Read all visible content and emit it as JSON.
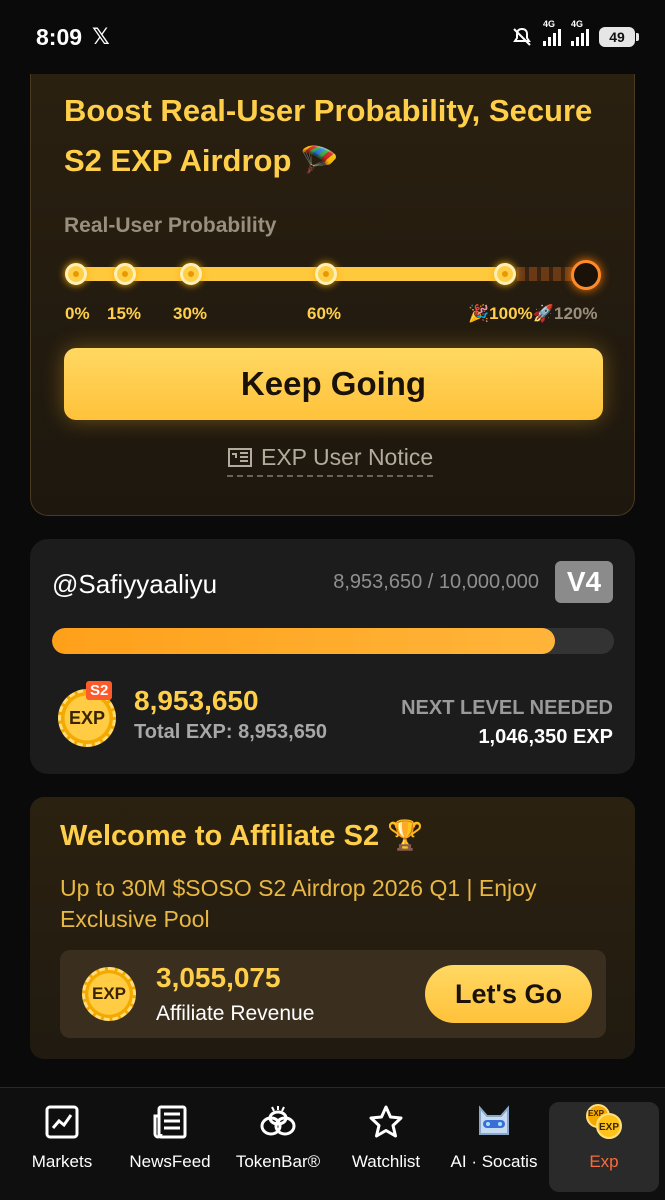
{
  "status_bar": {
    "time": "8:09",
    "x_label": "𝕏",
    "net1": "4G",
    "net2": "4G",
    "battery": "49"
  },
  "boost": {
    "title": "Boost Real-User Probability, Secure S2 EXP Airdrop 🪂",
    "probability_label": "Real-User Probability",
    "ticks": [
      "0%",
      "15%",
      "30%",
      "60%",
      "🎉100%🚀",
      "120%"
    ],
    "probability_progress_pct": 100,
    "button_label": "Keep Going",
    "notice_label": "EXP User Notice"
  },
  "level": {
    "username": "@Safiyyaaliyu",
    "progress_text": "8,953,650 / 10,000,000",
    "level_badge": "V4",
    "progress_fraction": 0.895,
    "season_tag": "S2",
    "coin_text": "EXP",
    "exp_value": "8,953,650",
    "total_exp": "Total EXP: 8,953,650",
    "next_level_label": "NEXT LEVEL NEEDED",
    "next_level_value": "1,046,350 EXP"
  },
  "affiliate": {
    "title": "Welcome to Affiliate S2 🏆",
    "subtitle": "Up to 30M $SOSO S2 Airdrop 2026 Q1 | Enjoy Exclusive Pool",
    "coin_text": "EXP",
    "revenue_value": "3,055,075",
    "revenue_label": "Affiliate Revenue",
    "button_label": "Let's Go"
  },
  "nav": {
    "items": [
      {
        "label": "Markets",
        "icon": "chart-icon"
      },
      {
        "label": "NewsFeed",
        "icon": "newspaper-icon"
      },
      {
        "label": "TokenBar®",
        "icon": "tokenbar-icon"
      },
      {
        "label": "Watchlist",
        "icon": "star-icon"
      },
      {
        "label": "AI · Socatis",
        "icon": "ai-cat-icon"
      },
      {
        "label": "Exp",
        "icon": "exp-icon"
      }
    ],
    "active_index": 5,
    "accent_color": "#ff6a3a"
  },
  "colors": {
    "brand_yellow": "#ffcf4a",
    "progress_orange": "#ffa01a"
  }
}
